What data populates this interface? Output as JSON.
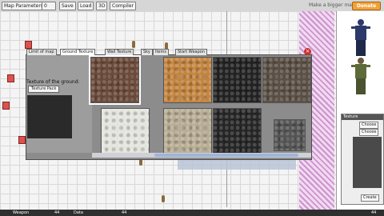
{
  "toolbar": {
    "map_parameters": "Map Parameters",
    "selector_value": "0",
    "save": "Save",
    "load": "Load",
    "three_d": "3D",
    "compiler": "Compiler",
    "make_bigger_map": "Make a bigger map",
    "donate": "Donate"
  },
  "dialog": {
    "tabs": [
      "Limit of map",
      "Ground Texture",
      "Wall Texture",
      "Sky",
      "Items",
      "Start Weapon"
    ],
    "active_tab": 1,
    "label": "Texture of the ground:",
    "texture_pack_button": "Texture Pack",
    "tile_colors": [
      "#6b4a3a",
      "#c4843f",
      "#222222",
      "#5c5046",
      "#e4e4de",
      "#b8ad94",
      "#262626",
      "#545454"
    ]
  },
  "right_panel": {
    "texture_label": "Texture",
    "choose_1": "Choose",
    "choose_2": "Choose",
    "create": "Create"
  },
  "bottom_bar": {
    "left": "Weapon",
    "left_count": "44",
    "mid": "Data",
    "mid_count": "44",
    "right_count": "44"
  },
  "icons": {
    "close": "close-icon",
    "player": "player-figure-icon",
    "marker": "map-marker-icon"
  },
  "colors": {
    "donate": "#f0a23a",
    "marker": "#d9534f",
    "hatch": "#c88ac8"
  }
}
